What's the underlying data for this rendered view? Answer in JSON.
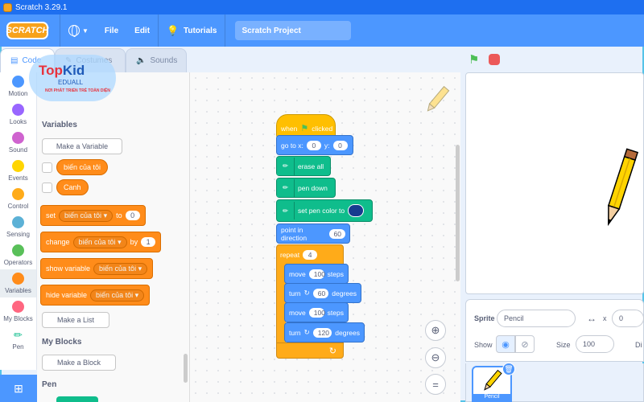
{
  "window": {
    "title": "Scratch 3.29.1"
  },
  "menubar": {
    "logo": "SCRATCH",
    "file": "File",
    "edit": "Edit",
    "tutorials": "Tutorials",
    "project_title": "Scratch Project"
  },
  "tabs": [
    {
      "label": "Code",
      "active": true
    },
    {
      "label": "Costumes",
      "active": false
    },
    {
      "label": "Sounds",
      "active": false
    }
  ],
  "categories": [
    {
      "label": "Motion",
      "color": "#4c97ff"
    },
    {
      "label": "Looks",
      "color": "#9966ff"
    },
    {
      "label": "Sound",
      "color": "#cf63cf"
    },
    {
      "label": "Events",
      "color": "#ffd500"
    },
    {
      "label": "Control",
      "color": "#ffab19"
    },
    {
      "label": "Sensing",
      "color": "#5cb1d6"
    },
    {
      "label": "Operators",
      "color": "#59c059"
    },
    {
      "label": "Variables",
      "color": "#ff8c1a"
    },
    {
      "label": "My Blocks",
      "color": "#ff6680"
    },
    {
      "label": "Pen",
      "color": "#0fbd8c"
    }
  ],
  "overlay_logo": {
    "brand_a": "Top",
    "brand_b": "Kid",
    "sub": "EDUALL",
    "tagline": "NƠI PHÁT TRIỂN TRẺ TOÀN DIỆN"
  },
  "palette": {
    "variables_heading": "Variables",
    "make_variable": "Make a Variable",
    "var1": "biến của tôi",
    "var2": "Canh",
    "set": {
      "label": "set",
      "var": "biến của tôi",
      "to": "to",
      "value": "0"
    },
    "change": {
      "label": "change",
      "var": "biến của tôi",
      "by": "by",
      "value": "1"
    },
    "show": {
      "label": "show variable",
      "var": "biến của tôi"
    },
    "hide": {
      "label": "hide variable",
      "var": "biến của tôi"
    },
    "make_list": "Make a List",
    "myblocks_heading": "My Blocks",
    "make_block": "Make a Block",
    "pen_heading": "Pen"
  },
  "script": {
    "when": "when",
    "clicked": "clicked",
    "goto": {
      "label": "go to x:",
      "x": "0",
      "ylabel": "y:",
      "y": "0"
    },
    "erase": "erase all",
    "pendown": "pen down",
    "setcolor": "set pen color to",
    "setcolor_value": "#173b8f",
    "point": {
      "label": "point in direction",
      "value": "60"
    },
    "repeat": {
      "label": "repeat",
      "value": "4"
    },
    "move1": {
      "label": "move",
      "value": "100",
      "unit": "steps"
    },
    "turn1": {
      "label": "turn",
      "value": "60",
      "unit": "degrees"
    },
    "move2": {
      "label": "move",
      "value": "100",
      "unit": "steps"
    },
    "turn2": {
      "label": "turn",
      "value": "120",
      "unit": "degrees"
    }
  },
  "sprite_info": {
    "sprite_label": "Sprite",
    "sprite_name": "Pencil",
    "x_label": "x",
    "x_value": "0",
    "show_label": "Show",
    "size_label": "Size",
    "size_value": "100",
    "direction_label": "Di",
    "thumbnail_label": "Pencil"
  }
}
